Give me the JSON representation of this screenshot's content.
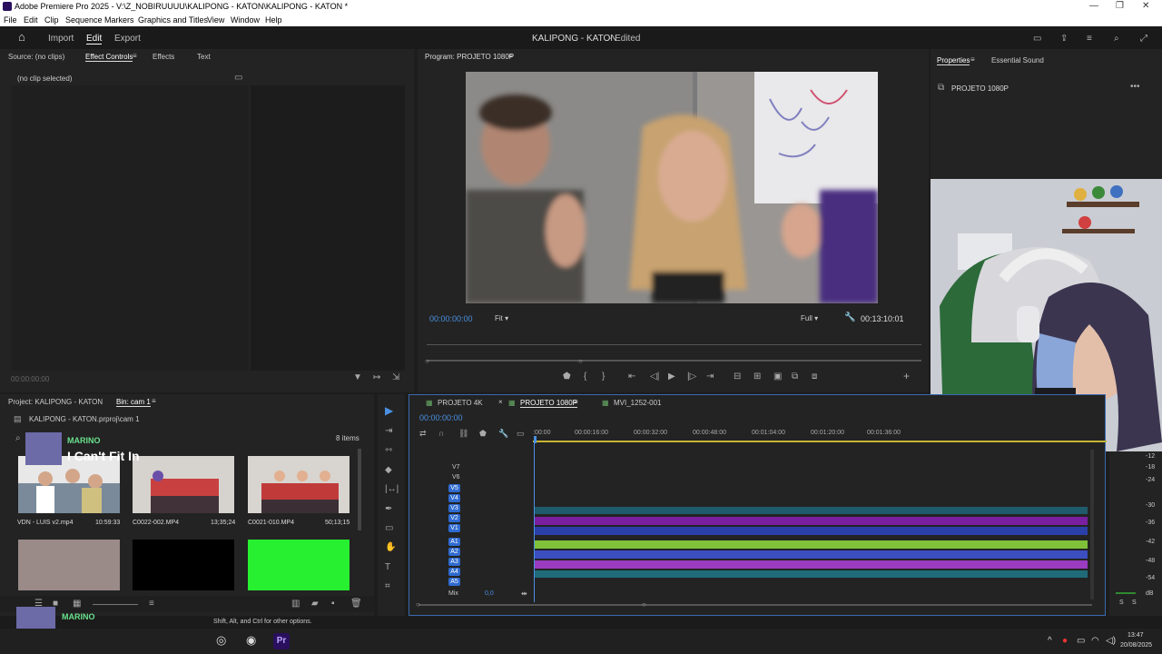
{
  "window": {
    "title": "Adobe Premiere Pro 2025 - V:\\Z_NOBIRUUUU\\KALIPONG - KATON\\KALIPONG - KATON *"
  },
  "menu": [
    "File",
    "Edit",
    "Clip",
    "Sequence",
    "Markers",
    "Graphics and Titles",
    "View",
    "Window",
    "Help"
  ],
  "appbar": {
    "import": "Import",
    "edit": "Edit",
    "export": "Export",
    "project_title": "KALIPONG - KATON",
    "status": "- Edited"
  },
  "source_panel": {
    "tabs": [
      "Source: (no clips)",
      "Effect Controls",
      "Effects",
      "Text"
    ],
    "no_clip": "(no clip selected)",
    "timecode": "00:00:00:00"
  },
  "program": {
    "title": "Program: PROJETO 1080P",
    "timecode": "00:00:00:00",
    "fit": "Fit",
    "quality": "Full",
    "duration": "00:13:10:01"
  },
  "properties": {
    "tabs": [
      "Properties",
      "Essential Sound"
    ],
    "item": "PROJETO 1080P"
  },
  "project": {
    "tab": "Project: KALIPONG - KATON",
    "bin": "Bin: cam 1",
    "path": "KALIPONG - KATON.prproj\\cam 1",
    "items_count": "8 items",
    "items": [
      {
        "name": "VDN - LUIS v2.mp4",
        "duration": "10:59:33"
      },
      {
        "name": "C0022-002.MP4",
        "duration": "13;35;24"
      },
      {
        "name": "C0021-010.MP4",
        "duration": "50;13;15"
      }
    ]
  },
  "timeline": {
    "tabs": [
      "PROJETO 4K",
      "PROJETO 1080P",
      "MVI_1252-001"
    ],
    "timecode": "00:00:00:00",
    "ruler": [
      ":00:00",
      "00:00:16:00",
      "00:00:32:00",
      "00:00:48:00",
      "00:01:04:00",
      "00:01:20:00",
      "00:01:36:00"
    ],
    "video_tracks": [
      "V7",
      "V6",
      "V5",
      "V4",
      "V3",
      "V2",
      "V1"
    ],
    "audio_tracks": [
      "A1",
      "A2",
      "A3",
      "A4",
      "A5"
    ],
    "mix": "Mix",
    "mix_value": "0,0"
  },
  "meter": {
    "labels": [
      "-12",
      "-18",
      "-24",
      "-30",
      "-36",
      "-42",
      "-48",
      "-54",
      "dB"
    ],
    "solo": "S"
  },
  "status_bar": {
    "hint": "Shift, Alt, and Ctrl for other options."
  },
  "overlay": {
    "artist": "MARINO",
    "song": "I Can't Fit In"
  },
  "taskbar": {
    "time": "13:47",
    "date": "20/08/2025"
  }
}
